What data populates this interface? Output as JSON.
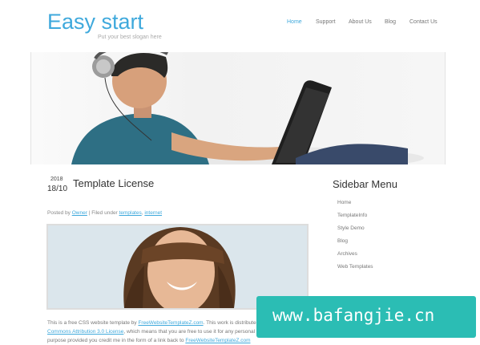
{
  "site": {
    "logo": "Easy start",
    "slogan": "Put your best slogan here"
  },
  "nav": {
    "items": [
      {
        "label": "Home",
        "active": true
      },
      {
        "label": "Support",
        "active": false
      },
      {
        "label": "About Us",
        "active": false
      },
      {
        "label": "Blog",
        "active": false
      },
      {
        "label": "Contact Us",
        "active": false
      }
    ]
  },
  "post": {
    "year": "2018",
    "day": "18/10",
    "title": "Template License",
    "meta": {
      "posted_by": "Posted by",
      "author": "Owner",
      "filed_under": "Filed under",
      "tag1": "templates",
      "tag2": "internet"
    },
    "body": {
      "l1_a": "This is a free CSS website template by ",
      "l1_link": "FreeWebsiteTemplateZ.com",
      "l1_b": ". This work is distribute",
      "l2_link": "Commons Attribution 3.0 License",
      "l2_b": ", which means that you are free to use it for any personal",
      "l3_a": "purpose provided you credit me in the form of a link back to ",
      "l3_link": "FreeWebsiteTemplateZ.com"
    }
  },
  "sidebar": {
    "title": "Sidebar Menu",
    "items": [
      "Home",
      "TemplateInfo",
      "Style Demo",
      "Blog",
      "Archives",
      "Web Templates"
    ]
  },
  "watermark": {
    "text": "www.bafangjie.cn",
    "color": "#2bbdb4"
  },
  "colors": {
    "accent": "#3fa9dc"
  }
}
